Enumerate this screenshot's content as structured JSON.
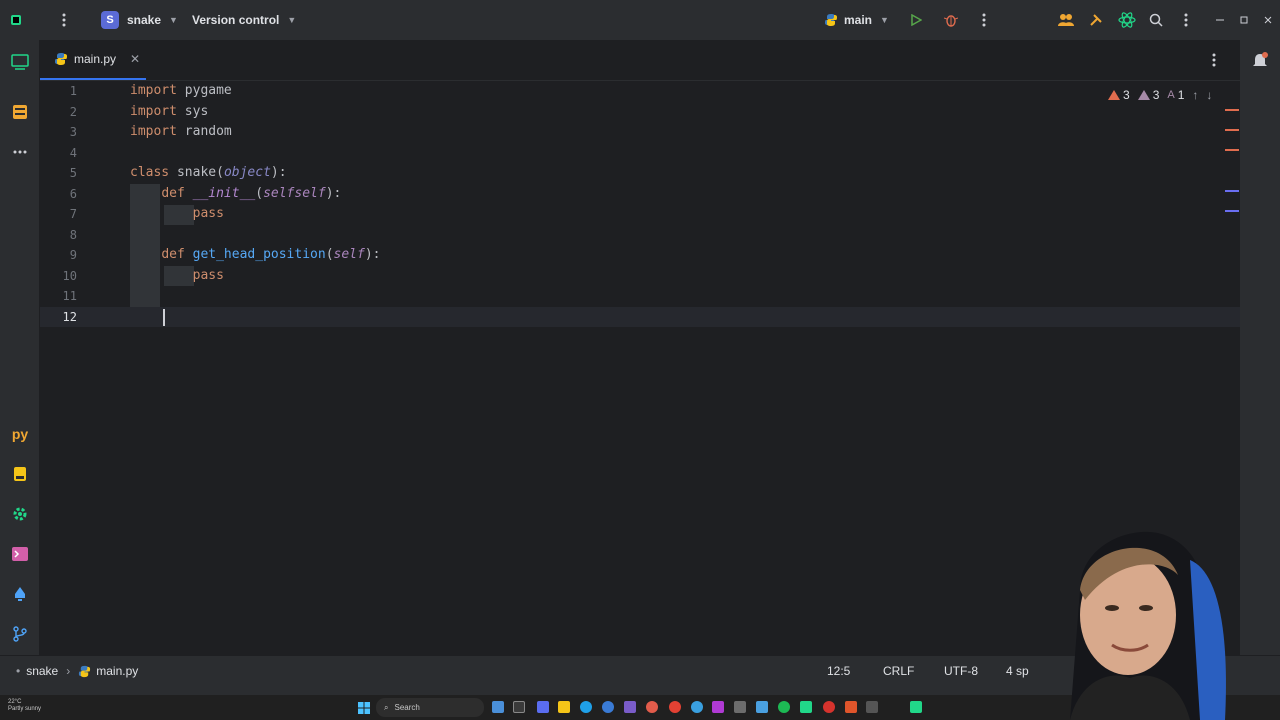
{
  "titlebar": {
    "project_initial": "S",
    "project_name": "snake",
    "vcs_label": "Version control",
    "run_config": "main"
  },
  "tabs": [
    {
      "label": "main.py",
      "active": true
    }
  ],
  "editor": {
    "line_numbers": [
      "1",
      "2",
      "3",
      "4",
      "5",
      "6",
      "7",
      "8",
      "9",
      "10",
      "11",
      "12"
    ],
    "current_line": "12",
    "lines": {
      "l1_kw": "import",
      "l1_mod": "pygame",
      "l2_kw": "import",
      "l2_mod": "sys",
      "l3_kw": "import",
      "l3_mod": "random",
      "l5_kw": "class",
      "l5_name": "snake",
      "l5_open": "(",
      "l5_base": "object",
      "l5_close": "):",
      "l6_kw": "def",
      "l6_name": "__init__",
      "l6_open": "(",
      "l6_param": "selfself",
      "l6_close": "):",
      "l7_kw": "pass",
      "l9_kw": "def",
      "l9_name": "get_head_position",
      "l9_open": "(",
      "l9_param": "self",
      "l9_close": "):",
      "l10_kw": "pass"
    },
    "inspections": {
      "errors": "3",
      "warnings": "3",
      "typos": "1"
    }
  },
  "statusbar": {
    "breadcrumb_project": "snake",
    "breadcrumb_file": "main.py",
    "position": "12:5",
    "line_sep": "CRLF",
    "encoding": "UTF-8",
    "indent": "4 sp"
  },
  "taskbar": {
    "weather_temp": "22°C",
    "weather_desc": "Partly sunny",
    "search_placeholder": "Search"
  },
  "colors": {
    "accent": "#3574f0",
    "keyword": "#cf8e6d",
    "error": "#e06c4e",
    "python_yellow": "#f5c518"
  }
}
